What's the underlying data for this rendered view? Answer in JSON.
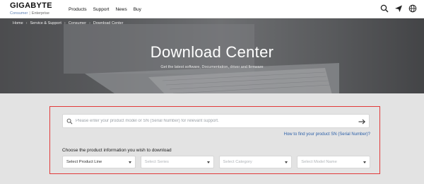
{
  "header": {
    "logo": "GIGABYTE",
    "sublinks": {
      "consumer": "Consumer",
      "separator": "|",
      "enterprise": "Enterprise"
    },
    "nav": [
      "Products",
      "Support",
      "News",
      "Buy"
    ],
    "icons": [
      "search-icon",
      "send-icon",
      "globe-icon"
    ]
  },
  "hero": {
    "breadcrumb": [
      "Home",
      "Service & Support",
      "Consumer",
      "Download Center"
    ],
    "title": "Download Center",
    "subtitle": "Get the latest software, Documentation, driver and firmware"
  },
  "search": {
    "placeholder": "Please enter your product model or SN (Serial Number) for relevant support.",
    "value": "",
    "sn_link": "How to find your product SN (Serial Number)?"
  },
  "selector": {
    "label": "Choose the product information you wish to download",
    "selects": [
      {
        "label": "Select Product Line",
        "enabled": true
      },
      {
        "label": "Select Series",
        "enabled": false
      },
      {
        "label": "Select Category",
        "enabled": false
      },
      {
        "label": "Select Model Name",
        "enabled": false
      }
    ]
  },
  "colors": {
    "highlight_border": "#e23a3a",
    "link": "#2b5fa8",
    "page_bg": "#e3e3e3"
  }
}
